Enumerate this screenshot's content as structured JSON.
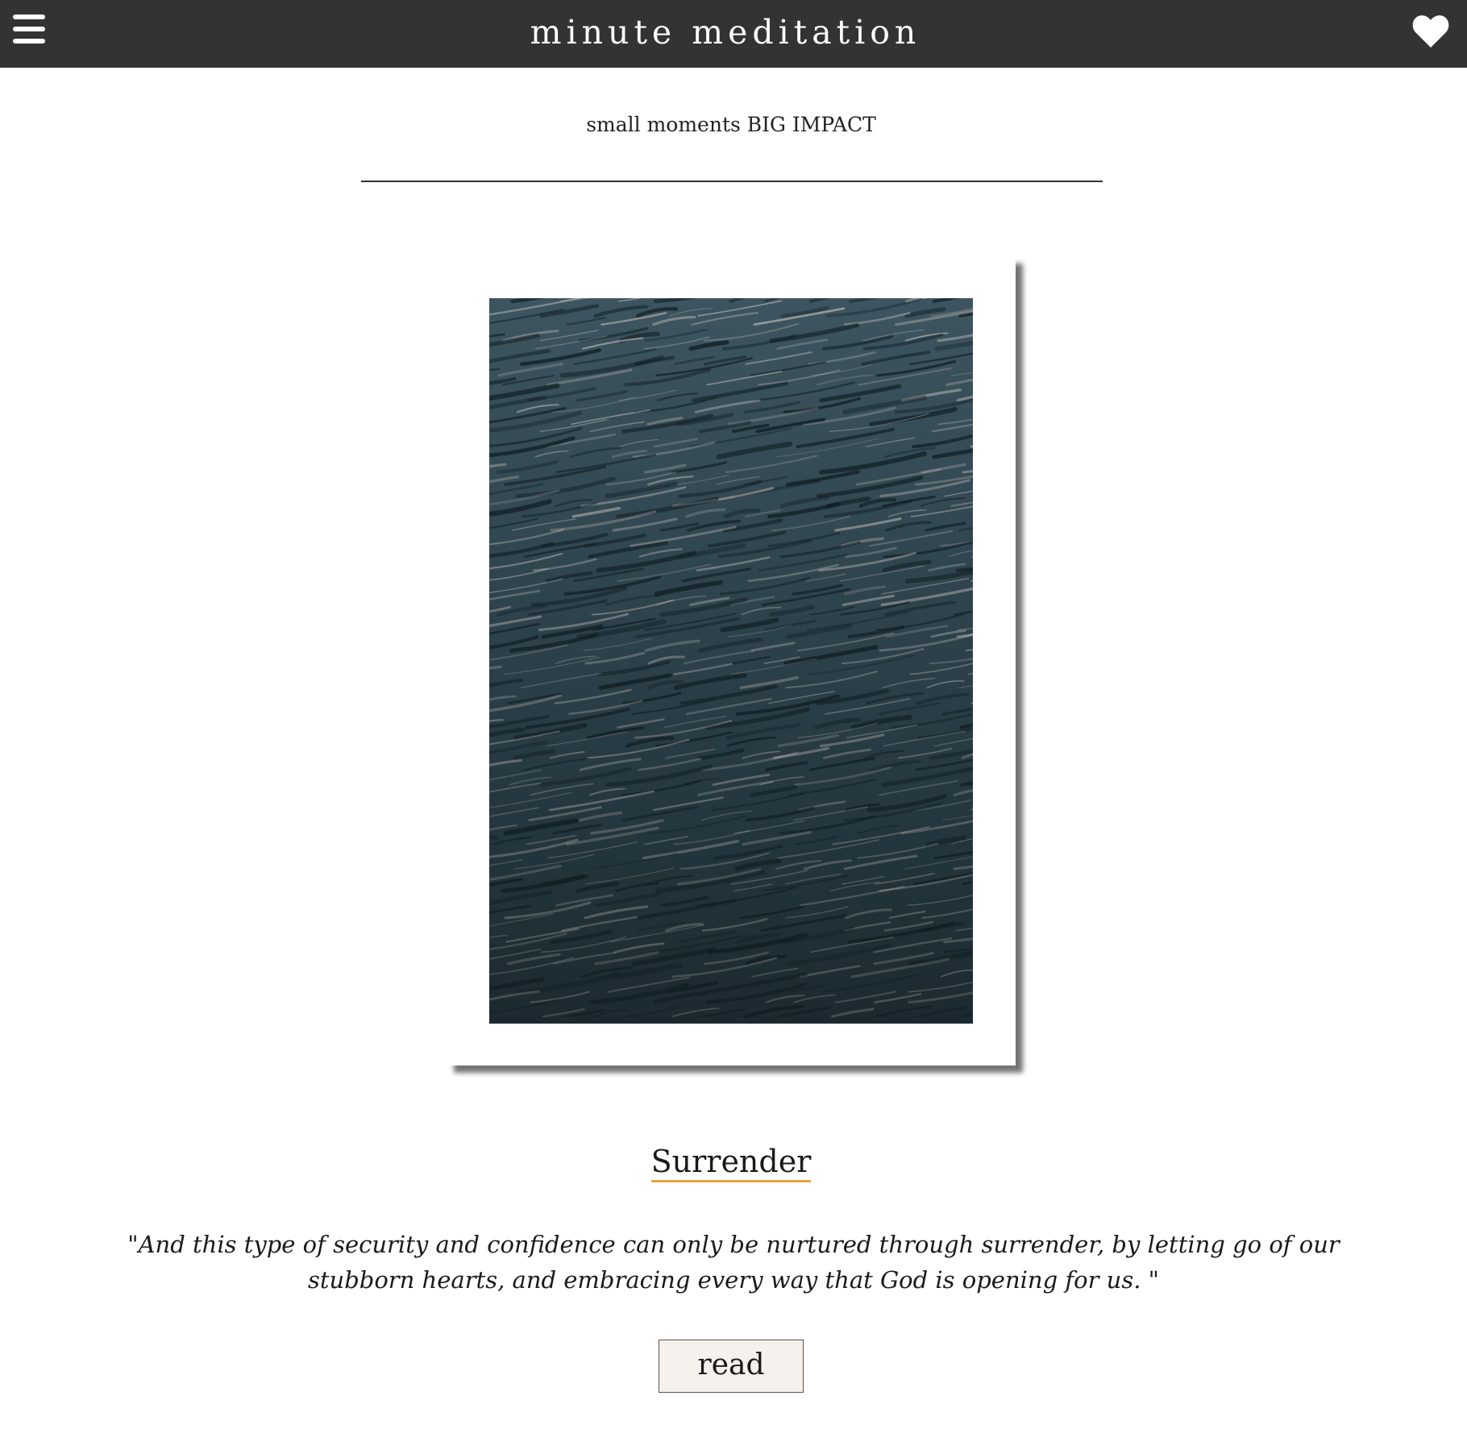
{
  "header": {
    "menu_icon": "hamburger-menu-icon",
    "title": "minute meditation",
    "favorite_icon": "heart-icon",
    "background_color": "#333333"
  },
  "tagline": "small moments BIG IMPACT",
  "featured": {
    "image_icon": "ocean-water-photo",
    "title": "Surrender",
    "title_underline_color": "#e8a23a",
    "quote": "\"And this type of security and confidence can only be nurtured through surrender, by letting go of our stubborn hearts, and embracing every way that God is opening for us. \"",
    "read_label": "read"
  }
}
